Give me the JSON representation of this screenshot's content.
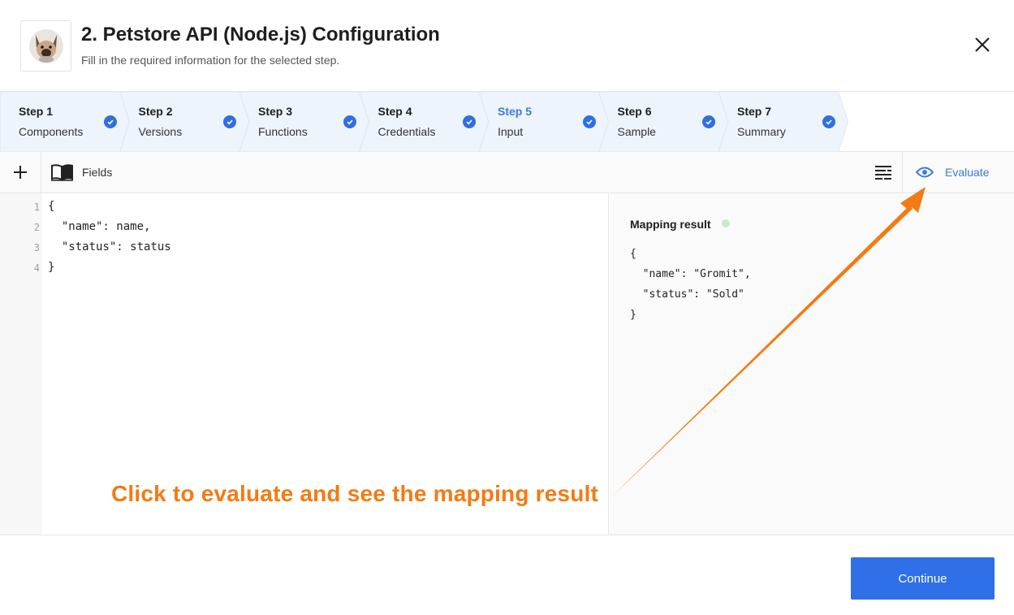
{
  "header": {
    "title": "2. Petstore API (Node.js) Configuration",
    "subtitle": "Fill in the required information for the selected step."
  },
  "steps": [
    {
      "num": "Step 1",
      "name": "Components",
      "state": "done"
    },
    {
      "num": "Step 2",
      "name": "Versions",
      "state": "done"
    },
    {
      "num": "Step 3",
      "name": "Functions",
      "state": "done"
    },
    {
      "num": "Step 4",
      "name": "Credentials",
      "state": "done"
    },
    {
      "num": "Step 5",
      "name": "Input",
      "state": "active"
    },
    {
      "num": "Step 6",
      "name": "Sample",
      "state": "done"
    },
    {
      "num": "Step 7",
      "name": "Summary",
      "state": "done"
    }
  ],
  "toolbar": {
    "fields_label": "Fields",
    "evaluate_label": "Evaluate",
    "icons": [
      "plus-icon",
      "book-icon",
      "format-icon",
      "eye-icon"
    ]
  },
  "editor": {
    "line_numbers": [
      "1",
      "2",
      "3",
      "4"
    ],
    "lines": [
      "{",
      "  \"name\": name,",
      "  \"status\": status",
      "}"
    ]
  },
  "result": {
    "title": "Mapping result",
    "lines": [
      "{",
      "  \"name\": \"Gromit\",",
      "  \"status\": \"Sold\"",
      "}"
    ]
  },
  "footer": {
    "continue_label": "Continue"
  },
  "annotation": {
    "text": "Click to evaluate and see the mapping result"
  },
  "colors": {
    "accent": "#2f6fe8",
    "active_step": "#3b7be0",
    "stepper_bg": "#eef4fc",
    "annotation": "#f47a12",
    "status_dot": "#c7ebc7"
  }
}
